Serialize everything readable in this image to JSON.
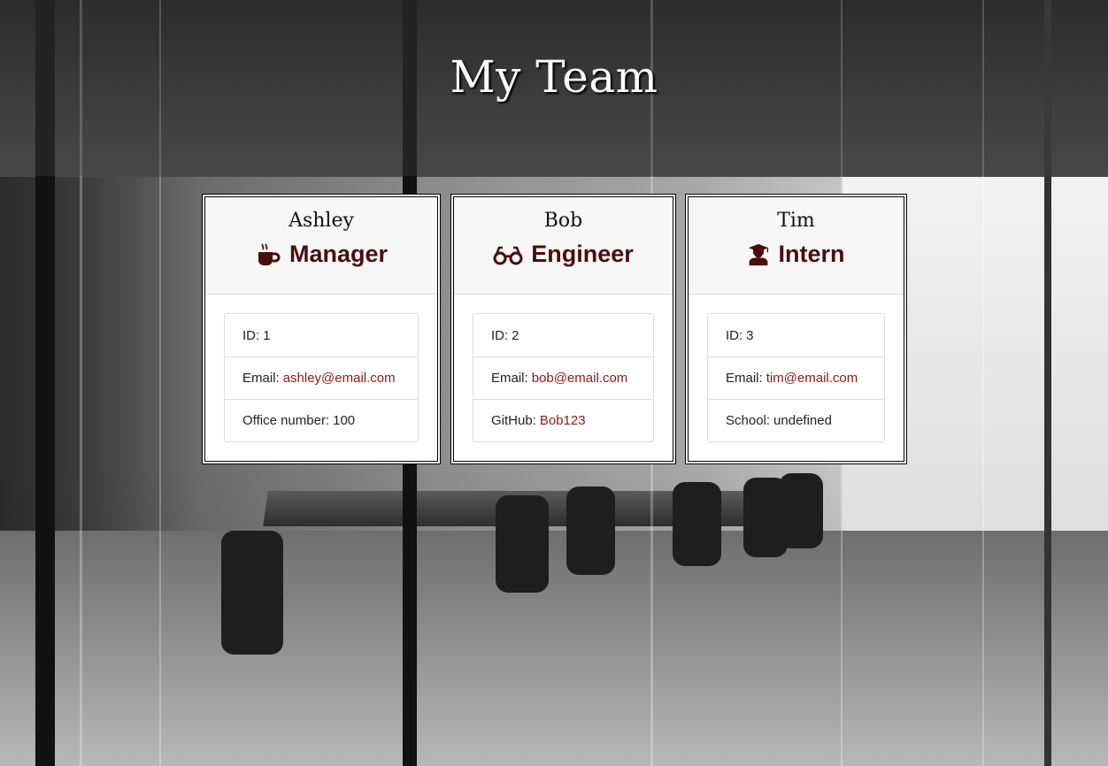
{
  "page": {
    "title": "My Team"
  },
  "colors": {
    "role_accent": "#4a0d0d",
    "link": "#8b1a1a",
    "card_header_bg": "#f7f7f7"
  },
  "team": [
    {
      "name": "Ashley",
      "role": "Manager",
      "icon": "coffee-icon",
      "id_label": "ID:",
      "id": "1",
      "email_label": "Email:",
      "email": "ashley@email.com",
      "extra_label": "Office number:",
      "extra_value": "100",
      "extra_is_link": false
    },
    {
      "name": "Bob",
      "role": "Engineer",
      "icon": "glasses-icon",
      "id_label": "ID:",
      "id": "2",
      "email_label": "Email:",
      "email": "bob@email.com",
      "extra_label": "GitHub:",
      "extra_value": "Bob123",
      "extra_is_link": true
    },
    {
      "name": "Tim",
      "role": "Intern",
      "icon": "graduate-icon",
      "id_label": "ID:",
      "id": "3",
      "email_label": "Email:",
      "email": "tim@email.com",
      "extra_label": "School:",
      "extra_value": "undefined",
      "extra_is_link": false
    }
  ]
}
